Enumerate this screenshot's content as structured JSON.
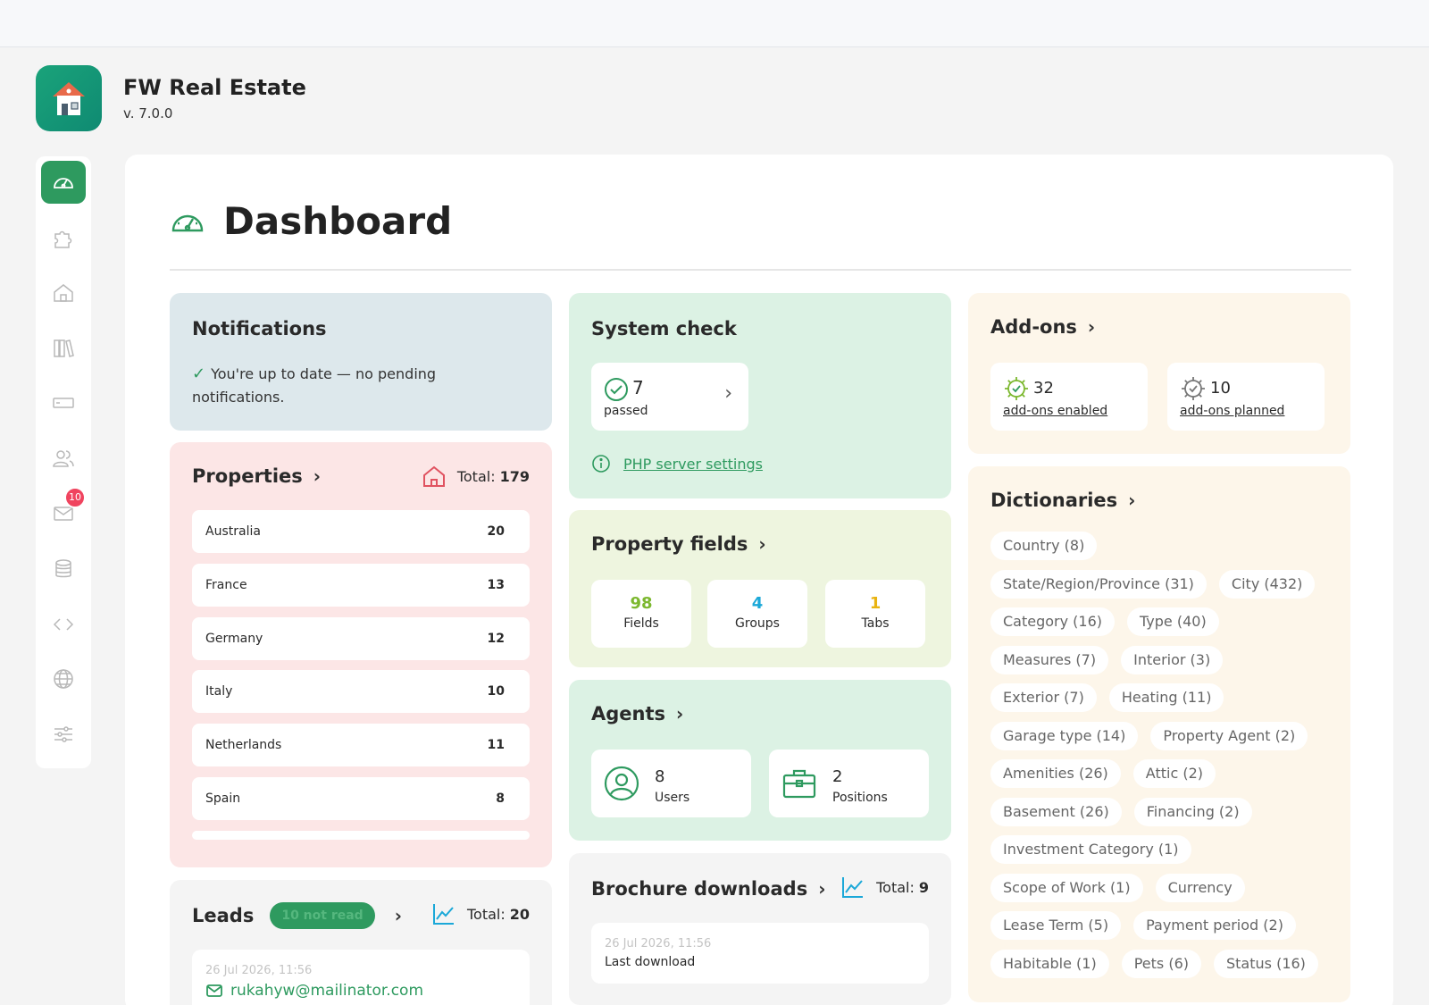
{
  "app": {
    "title": "FW Real Estate",
    "version": "v. 7.0.0"
  },
  "sidebar": {
    "badge": "10"
  },
  "page": {
    "title": "Dashboard"
  },
  "notifications": {
    "title": "Notifications",
    "message": "You're up to date — no pending notifications."
  },
  "properties": {
    "title": "Properties",
    "total_label": "Total:",
    "total": "179",
    "rows": [
      {
        "name": "Australia",
        "count": "20"
      },
      {
        "name": "France",
        "count": "13"
      },
      {
        "name": "Germany",
        "count": "12"
      },
      {
        "name": "Italy",
        "count": "10"
      },
      {
        "name": "Netherlands",
        "count": "11"
      },
      {
        "name": "Spain",
        "count": "8"
      }
    ]
  },
  "leads": {
    "title": "Leads",
    "badge": "10 not read",
    "total_label": "Total:",
    "total": "20",
    "latest_date": "26 Jul 2026, 11:56",
    "latest_email": "rukahyw@mailinator.com"
  },
  "system_check": {
    "title": "System check",
    "passed_count": "7",
    "passed_label": "passed",
    "link": "PHP server settings"
  },
  "property_fields": {
    "title": "Property fields",
    "fields": {
      "value": "98",
      "label": "Fields"
    },
    "groups": {
      "value": "4",
      "label": "Groups"
    },
    "tabs": {
      "value": "1",
      "label": "Tabs"
    }
  },
  "agents": {
    "title": "Agents",
    "users": {
      "value": "8",
      "label": "Users"
    },
    "positions": {
      "value": "2",
      "label": "Positions"
    }
  },
  "brochure": {
    "title": "Brochure downloads",
    "total_label": "Total:",
    "total": "9",
    "last_date": "26 Jul 2026, 11:56",
    "last_label": "Last download"
  },
  "addons": {
    "title": "Add-ons",
    "enabled": {
      "value": "32",
      "label": "add-ons enabled"
    },
    "planned": {
      "value": "10",
      "label": "add-ons planned"
    }
  },
  "dictionaries": {
    "title": "Dictionaries",
    "items": [
      "Country (8)",
      "State/Region/Province (31)",
      "City (432)",
      "Category (16)",
      "Type (40)",
      "Measures (7)",
      "Interior (3)",
      "Exterior (7)",
      "Heating (11)",
      "Garage type (14)",
      "Property Agent (2)",
      "Amenities (26)",
      "Attic (2)",
      "Basement (26)",
      "Financing (2)",
      "Investment Category (1)",
      "Scope of Work (1)",
      "Currency",
      "Lease Term (5)",
      "Payment period (2)",
      "Habitable (1)",
      "Pets (6)",
      "Status (16)"
    ]
  },
  "colors": {
    "accent": "#2e9a5f",
    "fields": "#7cb82f",
    "groups": "#1ba8d8",
    "tabs": "#e9b310",
    "badge": "#f0445f",
    "home_icon": "#e05260",
    "chart_icon": "#1ba8d8"
  }
}
